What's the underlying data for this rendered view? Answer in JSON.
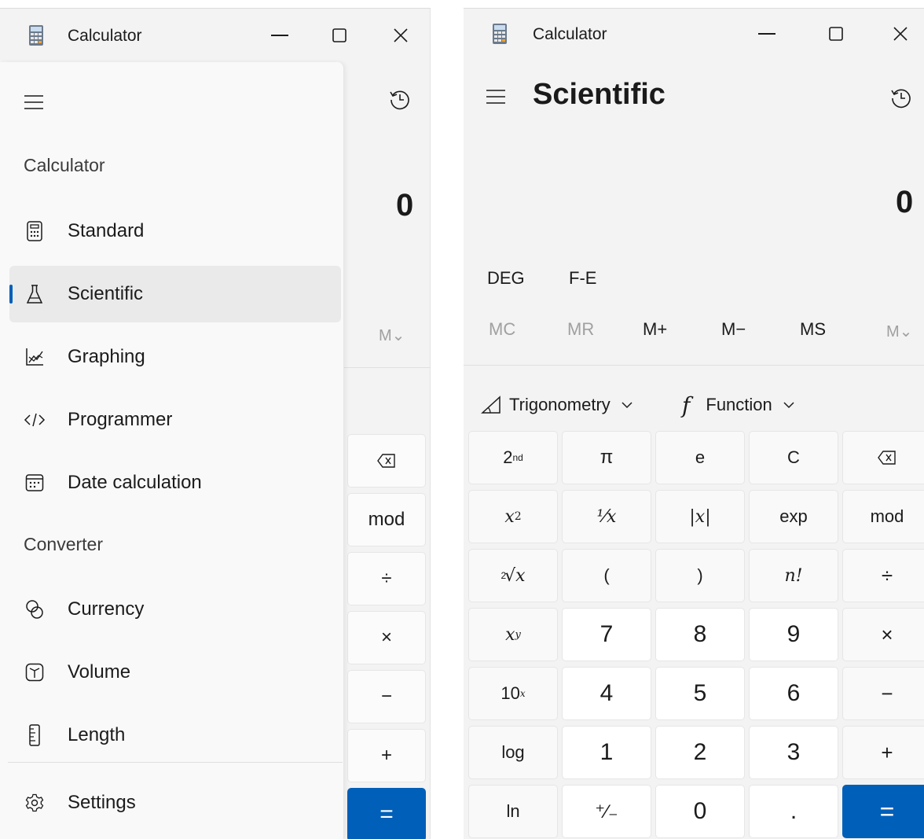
{
  "left_window": {
    "title": "Calculator",
    "nav": {
      "calculator_header": "Calculator",
      "converter_header": "Converter",
      "items": [
        {
          "label": "Standard",
          "icon": "standard-calculator-icon"
        },
        {
          "label": "Scientific",
          "icon": "flask-icon"
        },
        {
          "label": "Graphing",
          "icon": "graph-icon"
        },
        {
          "label": "Programmer",
          "icon": "code-icon"
        },
        {
          "label": "Date calculation",
          "icon": "calendar-icon"
        }
      ],
      "converter_items": [
        {
          "label": "Currency",
          "icon": "currency-icon"
        },
        {
          "label": "Volume",
          "icon": "cube-icon"
        },
        {
          "label": "Length",
          "icon": "ruler-icon"
        }
      ],
      "settings_label": "Settings"
    },
    "display": "0",
    "memory_dropdown": "M⌄",
    "visible_keys": [
      "⌫",
      "mod",
      "÷",
      "×",
      "−",
      "+",
      "="
    ]
  },
  "right_window": {
    "title": "Calculator",
    "mode_title": "Scientific",
    "display": "0",
    "angle_mode": "DEG",
    "fe_label": "F-E",
    "memory": [
      "MC",
      "MR",
      "M+",
      "M−",
      "MS",
      "M⌄"
    ],
    "trig_label": "Trigonometry",
    "function_label": "Function",
    "function_icon": "f",
    "keys": {
      "r1": [
        "π",
        "e",
        "C",
        "mod"
      ],
      "second_base": "2",
      "second_sup": "nd",
      "x2_base": "x",
      "x2_sup": "2",
      "reciprocal": "¹⁄x",
      "abs": "|x|",
      "exp": "exp",
      "root_idx": "2",
      "root_sym": "√x",
      "open_paren": "(",
      "close_paren": ")",
      "factorial": "n!",
      "divide": "÷",
      "xy_base": "x",
      "xy_sup": "y",
      "n7": "7",
      "n8": "8",
      "n9": "9",
      "multiply": "×",
      "ten_base": "10",
      "ten_sup": "x",
      "n4": "4",
      "n5": "5",
      "n6": "6",
      "minus": "−",
      "log": "log",
      "n1": "1",
      "n2": "2",
      "n3": "3",
      "plus": "+",
      "ln": "ln",
      "plusminus": "⁺∕₋",
      "n0": "0",
      "decimal": ".",
      "equals": "="
    }
  }
}
